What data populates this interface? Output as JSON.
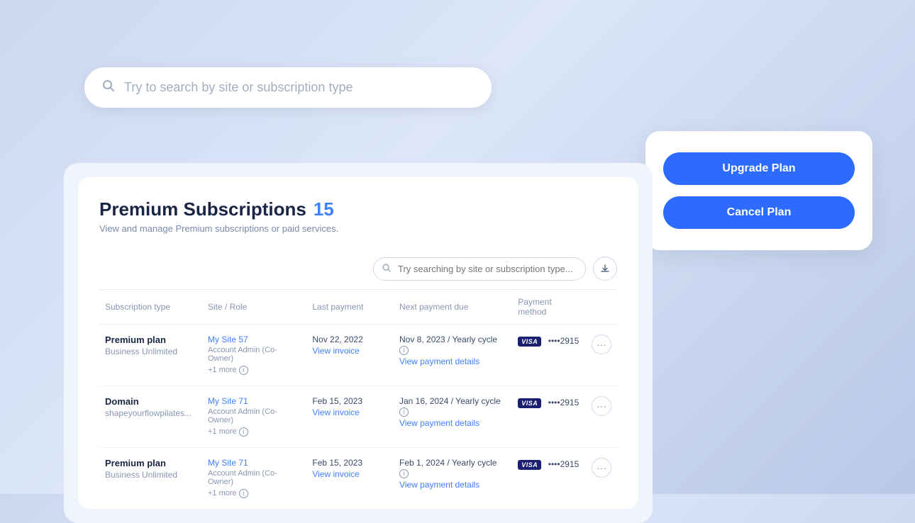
{
  "search": {
    "placeholder": "Try to search by site or subscription type",
    "table_placeholder": "Try searching by site or subscription type..."
  },
  "action_card": {
    "upgrade_label": "Upgrade Plan",
    "cancel_label": "Cancel Plan"
  },
  "premium": {
    "title": "Premium Subscriptions",
    "count": "15",
    "subtitle": "View and manage Premium subscriptions or paid services."
  },
  "table": {
    "headers": [
      "Subscription type",
      "Site / Role",
      "Last payment",
      "Next payment due",
      "Payment method"
    ],
    "rows": [
      {
        "sub_name": "Premium plan",
        "sub_detail": "Business Unlimited",
        "site_name": "My Site 57",
        "site_role": "Account Admin (Co-Owner)",
        "site_more": "+1 more",
        "last_payment": "Nov 22, 2022",
        "view_invoice": "View invoice",
        "next_payment": "Nov 8, 2023 / Yearly cycle",
        "view_payment": "View payment details",
        "card_brand": "VISA",
        "card_dots": "••••2915"
      },
      {
        "sub_name": "Domain",
        "sub_detail": "shapeyourflowpilates...",
        "site_name": "My Site 71",
        "site_role": "Account Admin (Co-Owner)",
        "site_more": "+1 more",
        "last_payment": "Feb 15, 2023",
        "view_invoice": "View invoice",
        "next_payment": "Jan 16, 2024 / Yearly cycle",
        "view_payment": "View payment details",
        "card_brand": "VISA",
        "card_dots": "••••2915"
      },
      {
        "sub_name": "Premium plan",
        "sub_detail": "Business Unlimited",
        "site_name": "My Site 71",
        "site_role": "Account Admin (Co-Owner)",
        "site_more": "+1 more",
        "last_payment": "Feb 15, 2023",
        "view_invoice": "View invoice",
        "next_payment": "Feb 1, 2024 / Yearly cycle",
        "view_payment": "View payment details",
        "card_brand": "VISA",
        "card_dots": "••••2915"
      }
    ]
  }
}
